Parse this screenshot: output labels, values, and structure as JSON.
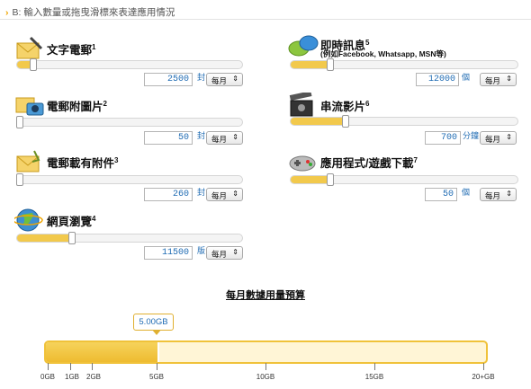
{
  "header": {
    "chevron": "›",
    "text": "B: 輸入數量或拖曳滑標來表達應用情況"
  },
  "items": [
    {
      "key": "email",
      "title": "文字電郵",
      "sup": "1",
      "subtitle": "",
      "icon": "email-icon",
      "qty": "2500",
      "unit": "封",
      "period": "每月",
      "fill": 0.06
    },
    {
      "key": "im",
      "title": "即時訊息",
      "sup": "5",
      "subtitle": "(例如Facebook, Whatsapp, MSN等)",
      "icon": "chat-bubble-icon",
      "qty": "12000",
      "unit": "個",
      "period": "每月",
      "fill": 0.16
    },
    {
      "key": "photo",
      "title": "電郵附圖片",
      "sup": "2",
      "subtitle": "",
      "icon": "camera-icon",
      "qty": "50",
      "unit": "封",
      "period": "每月",
      "fill": 0.0
    },
    {
      "key": "video",
      "title": "串流影片",
      "sup": "6",
      "subtitle": "",
      "icon": "film-icon",
      "qty": "700",
      "unit": "分鐘",
      "period": "每月",
      "fill": 0.23
    },
    {
      "key": "attach",
      "title": "電郵載有附件",
      "sup": "3",
      "subtitle": "",
      "icon": "attachment-icon",
      "qty": "260",
      "unit": "封",
      "period": "每月",
      "fill": 0.0
    },
    {
      "key": "apps",
      "title": "應用程式/遊戲下載",
      "sup": "7",
      "subtitle": "",
      "icon": "gamepad-icon",
      "qty": "50",
      "unit": "個",
      "period": "每月",
      "fill": 0.16
    },
    {
      "key": "web",
      "title": "網頁瀏覽",
      "sup": "4",
      "subtitle": "",
      "icon": "globe-icon",
      "qty": "11500",
      "unit": "版",
      "period": "每月",
      "fill": 0.23
    }
  ],
  "period_arrow": "⇕",
  "budget": {
    "title": "每月數據用量預算",
    "value_label": "5.00GB",
    "used_gb": 5,
    "max_gb": 20,
    "ticks": [
      "0GB",
      "1GB",
      "2GB",
      "5GB",
      "10GB",
      "15GB",
      "20+GB"
    ]
  },
  "colors": {
    "accent": "#f2c94c",
    "number": "#1f6bb3",
    "chevron": "#f0a500"
  }
}
